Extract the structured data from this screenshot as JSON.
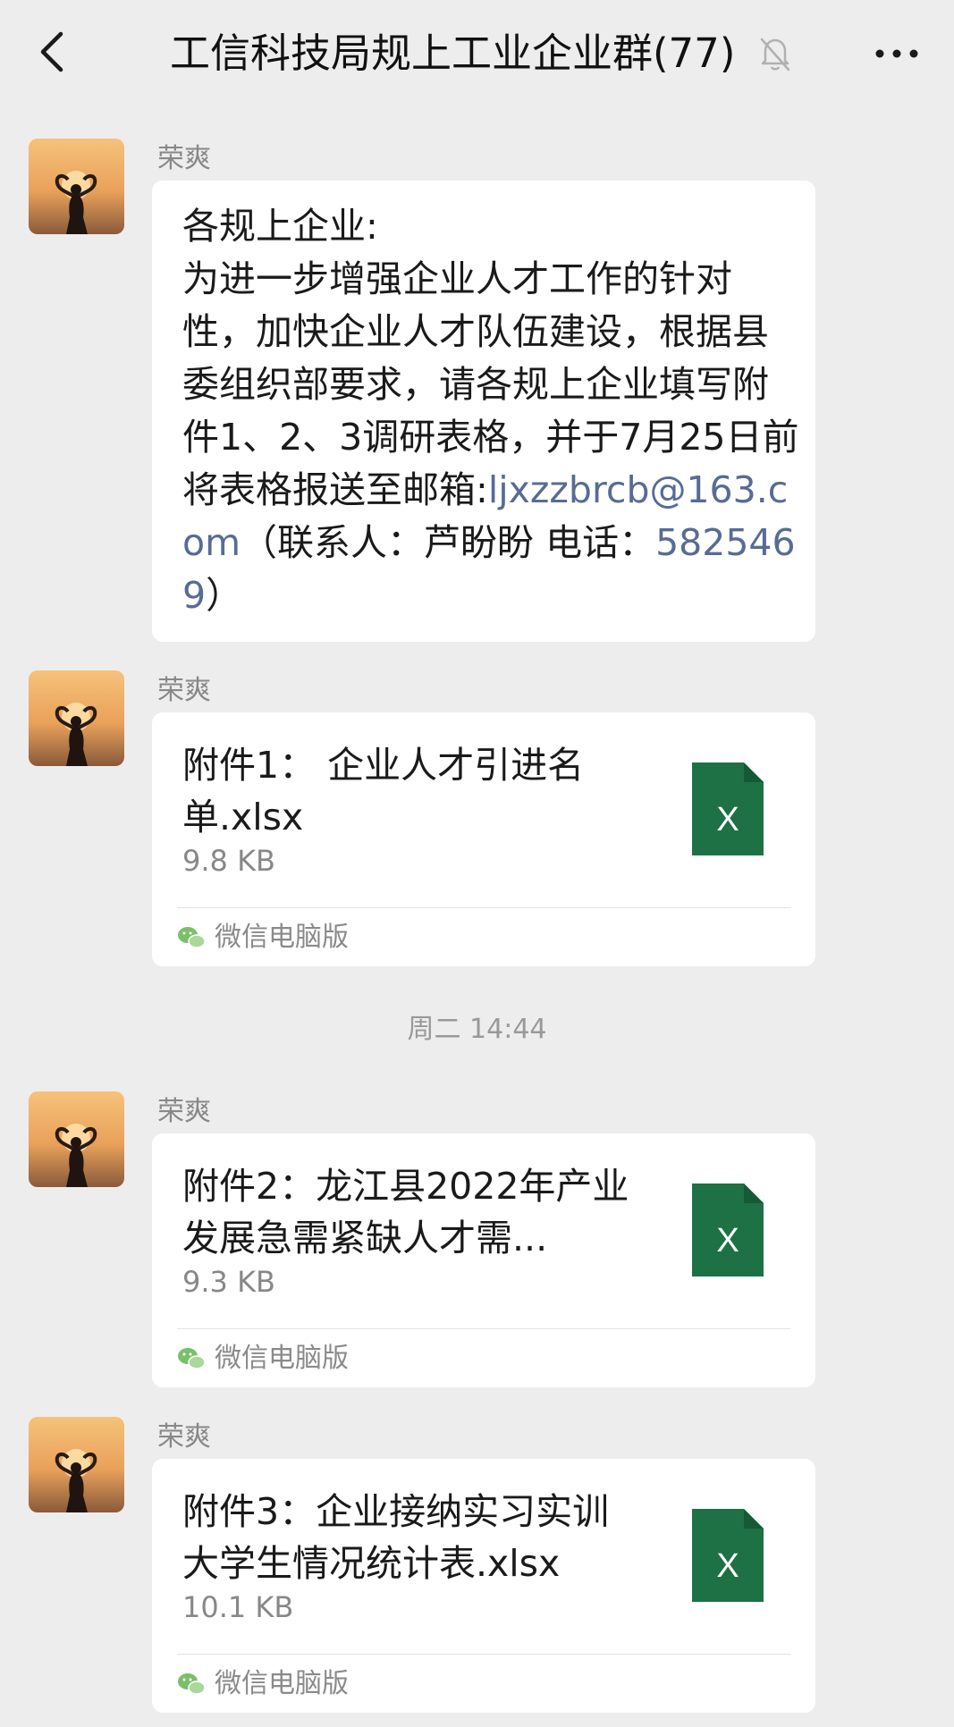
{
  "header": {
    "title": "工信科技局规上工业企业群(77)"
  },
  "messages": [
    {
      "sender": "荣爽",
      "text_before_link": "各规上企业:\n为进一步增强企业人才工作的针对性，加快企业人才队伍建设，根据县委组织部要求，请各规上企业填写附件1、2、3调研表格，并于7月25日前将表格报送至邮箱:",
      "email": "ljxzzbrcb@163.com",
      "text_middle": "（联系人：芦盼盼 电话：",
      "phone": "5825469",
      "text_end": "）"
    },
    {
      "sender": "荣爽",
      "file_name": "附件1： 企业人才引进名单.xlsx",
      "file_size": "9.8 KB",
      "source": "微信电脑版"
    },
    {
      "sender": "荣爽",
      "file_name": "附件2：龙江县2022年产业发展急需紧缺人才需...",
      "file_size": "9.3 KB",
      "source": "微信电脑版"
    },
    {
      "sender": "荣爽",
      "file_name": "附件3：企业接纳实习实训大学生情况统计表.xlsx",
      "file_size": "10.1 KB",
      "source": "微信电脑版"
    }
  ],
  "timestamp": "周二 14:44",
  "colors": {
    "background": "#ededed",
    "bubble": "#ffffff",
    "link": "#576b95",
    "excel_green": "#1e7145"
  },
  "icons": {
    "back": "chevron-left-icon",
    "mute": "bell-off-icon",
    "more": "more-icon",
    "file": "excel-file-icon",
    "source": "wechat-icon"
  }
}
